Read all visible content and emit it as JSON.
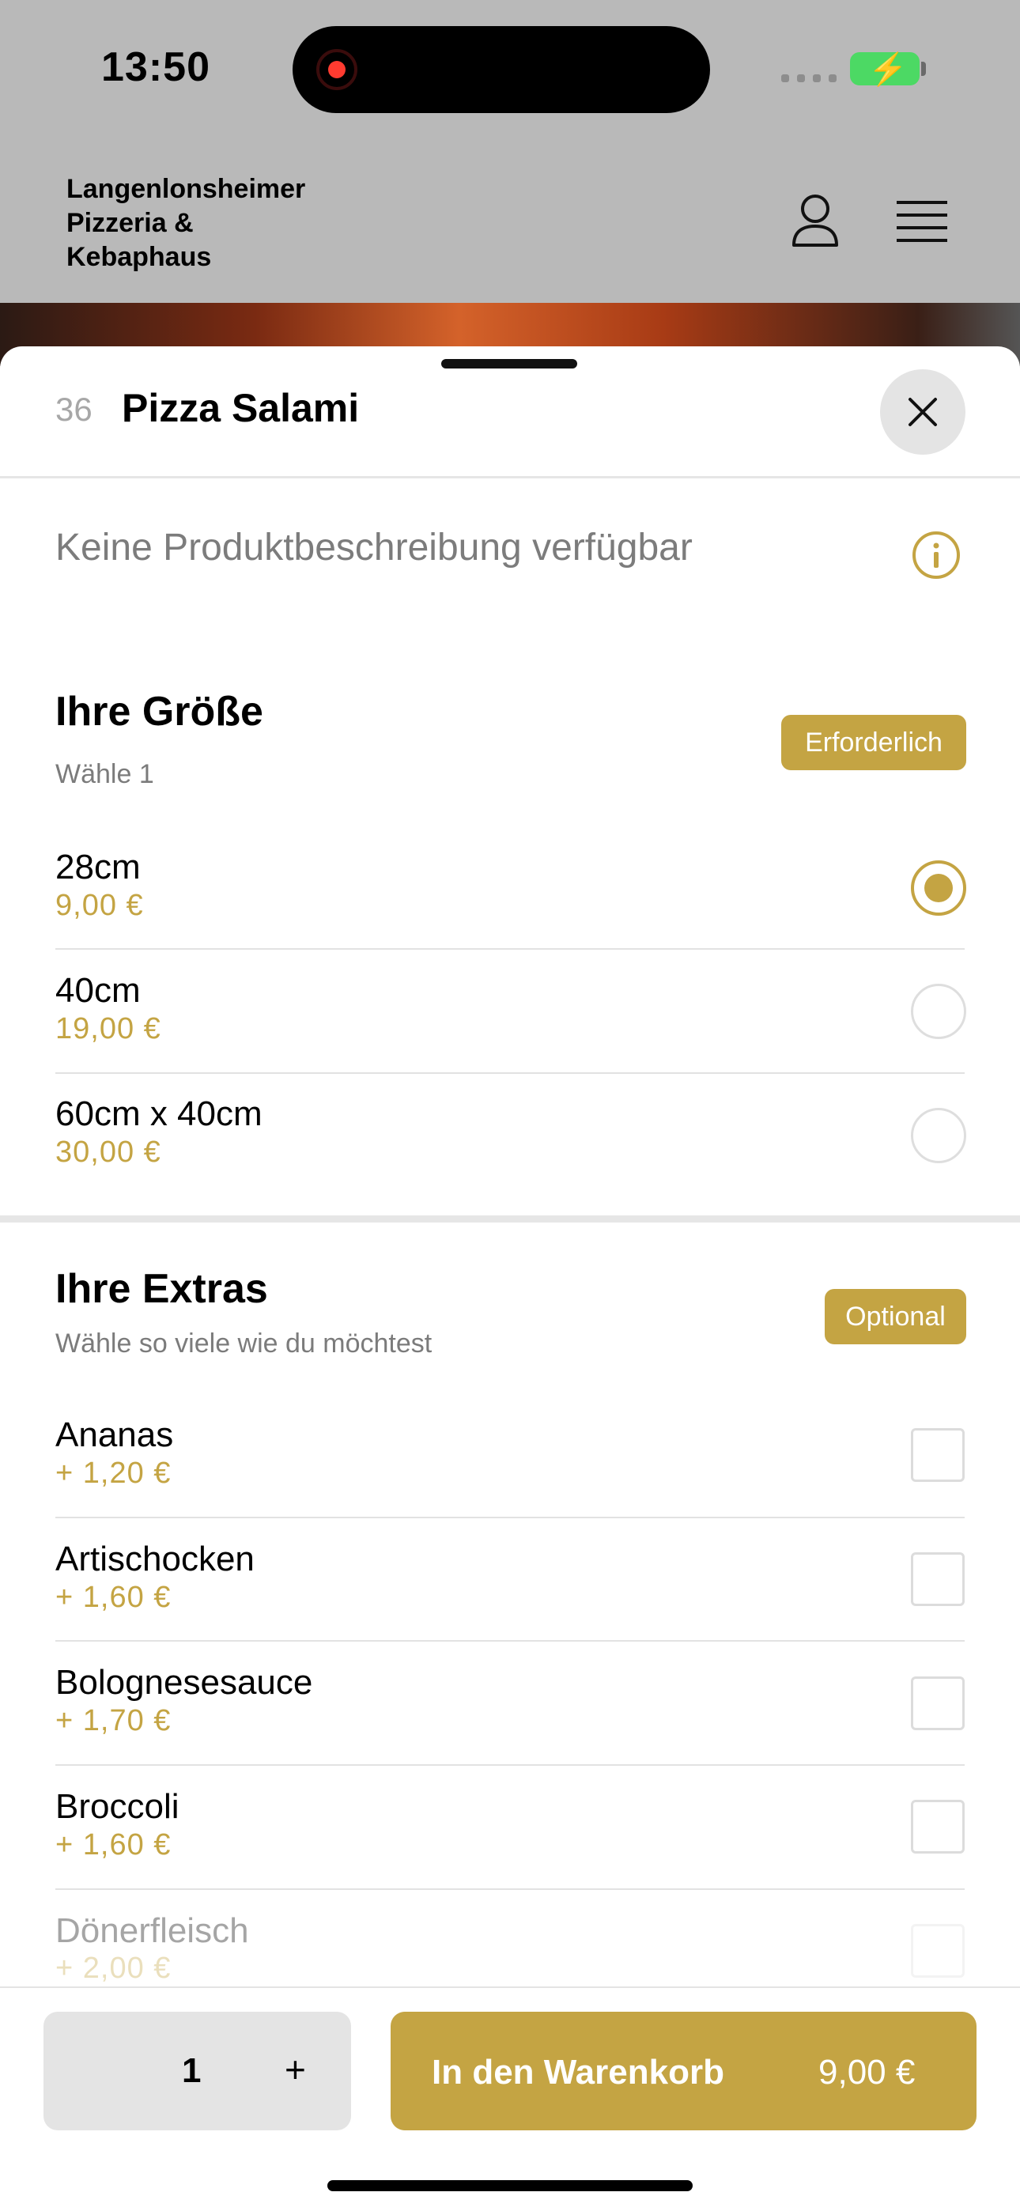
{
  "status": {
    "time": "13:50"
  },
  "header": {
    "brand_lines": [
      "Langenlonsheimer",
      "Pizzeria &",
      "Kebaphaus"
    ]
  },
  "product": {
    "number": "36",
    "title": "Pizza Salami",
    "description": "Keine Produktbeschreibung verfügbar"
  },
  "sizes": {
    "title": "Ihre Größe",
    "subtitle": "Wähle 1",
    "badge": "Erforderlich",
    "selected_index": 0,
    "options": [
      {
        "name": "28cm",
        "price": "9,00 €"
      },
      {
        "name": "40cm",
        "price": "19,00 €"
      },
      {
        "name": "60cm x 40cm",
        "price": "30,00 €"
      }
    ]
  },
  "extras": {
    "title": "Ihre Extras",
    "subtitle": "Wähle so viele wie du möchtest",
    "badge": "Optional",
    "options": [
      {
        "name": "Ananas",
        "price": "+ 1,20 €"
      },
      {
        "name": "Artischocken",
        "price": "+ 1,60 €"
      },
      {
        "name": "Bolognesesauce",
        "price": "+ 1,70 €"
      },
      {
        "name": "Broccoli",
        "price": "+ 1,60 €"
      },
      {
        "name": "Dönerfleisch",
        "price": "+ 2,00 €"
      }
    ]
  },
  "footer": {
    "quantity": "1",
    "plus": "+",
    "cart_label": "In den Warenkorb",
    "cart_price": "9,00 €"
  },
  "colors": {
    "accent": "#c4a443",
    "header_bg": "#b9b9b9",
    "battery": "#4cd964"
  },
  "icons": [
    "user-icon",
    "menu-icon",
    "close-icon",
    "info-icon"
  ]
}
